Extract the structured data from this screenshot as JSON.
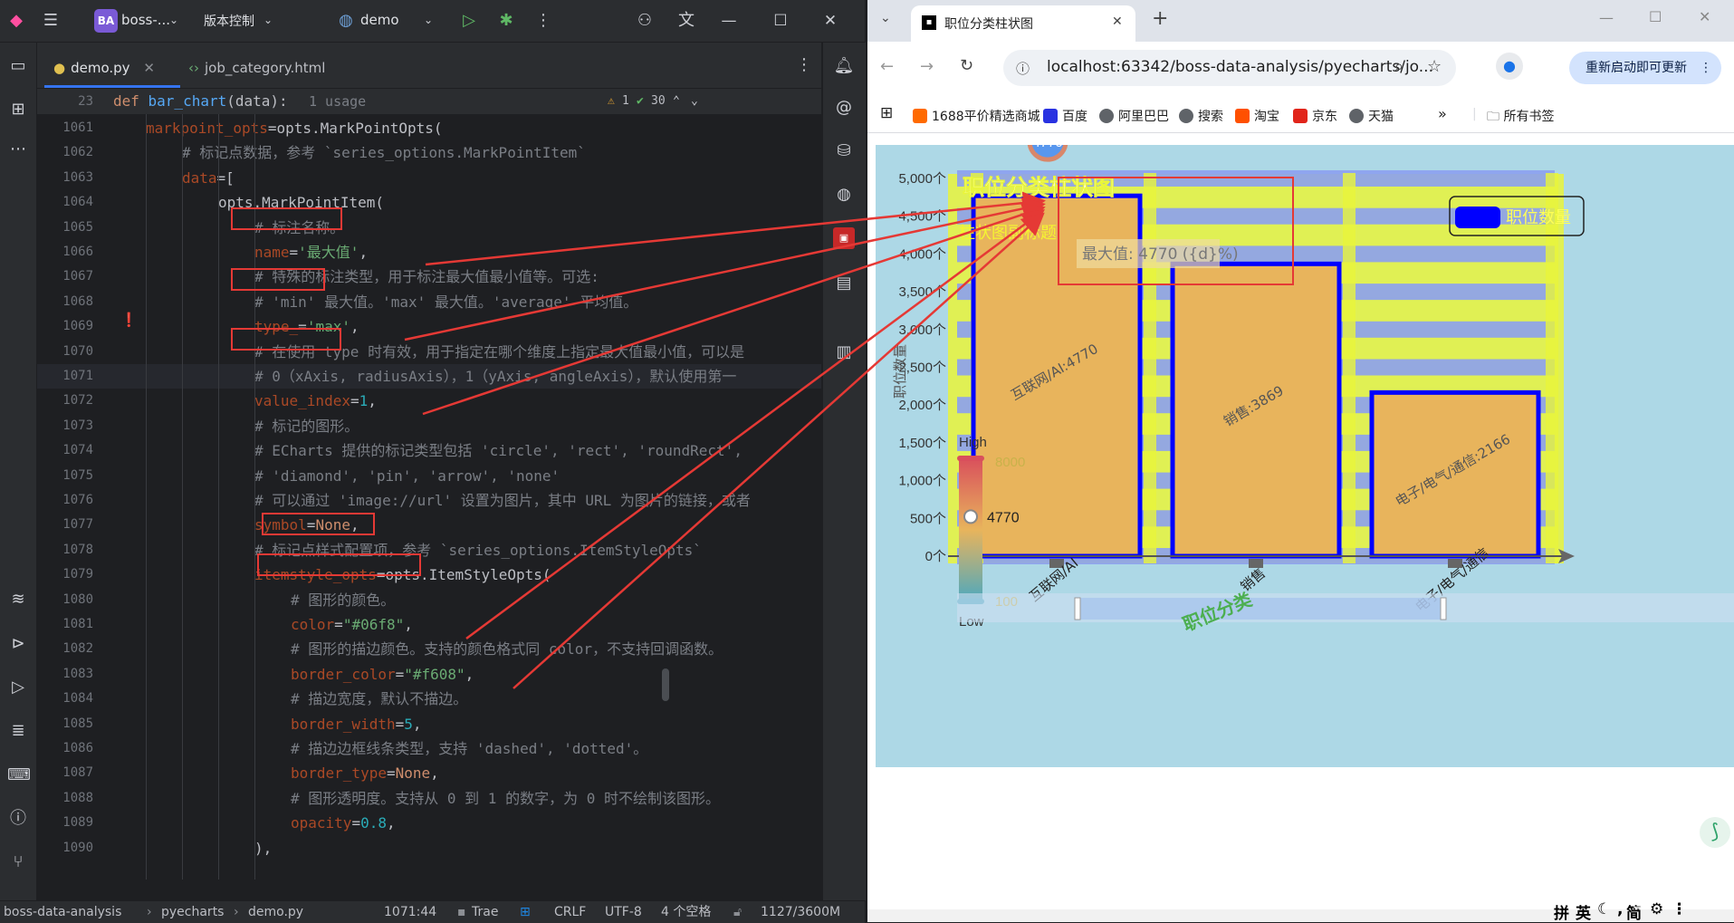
{
  "ide": {
    "project_badge": "BA",
    "project_name": "boss-...",
    "vcs_label": "版本控制",
    "run_config": "demo",
    "tabs": [
      {
        "label": "demo.py",
        "active": true
      },
      {
        "label": "job_category.html",
        "active": false
      }
    ],
    "sticky": {
      "line_no": "23",
      "def_text": "def bar_chart(data):",
      "usages": "1 usage",
      "warnings": "1",
      "checks": "30"
    },
    "lines": [
      {
        "no": "1061",
        "indent": 1,
        "tokens": [
          [
            "pa",
            "markpoint_opts"
          ],
          [
            "",
            "=opts.MarkPointOpts("
          ]
        ]
      },
      {
        "no": "1062",
        "indent": 2,
        "tokens": [
          [
            "cm",
            "# 标记点数据，参考 `series_options.MarkPointItem`"
          ]
        ]
      },
      {
        "no": "1063",
        "indent": 2,
        "tokens": [
          [
            "pa",
            "data"
          ],
          [
            "",
            "=["
          ]
        ]
      },
      {
        "no": "1064",
        "indent": 3,
        "tokens": [
          [
            "",
            "opts.MarkPointItem("
          ]
        ]
      },
      {
        "no": "1065",
        "indent": 4,
        "tokens": [
          [
            "cm",
            "# 标注名称。"
          ]
        ]
      },
      {
        "no": "1066",
        "indent": 4,
        "tokens": [
          [
            "pa",
            "name"
          ],
          [
            "",
            "="
          ],
          [
            "str",
            "'最大值'"
          ],
          [
            "",
            ","
          ]
        ]
      },
      {
        "no": "1067",
        "indent": 4,
        "tokens": [
          [
            "cm",
            "# 特殊的标注类型，用于标注最大值最小值等。可选:"
          ]
        ]
      },
      {
        "no": "1068",
        "indent": 4,
        "tokens": [
          [
            "cm",
            "# 'min' 最大值。'max' 最大值。'average' 平均值。"
          ]
        ]
      },
      {
        "no": "1069",
        "indent": 4,
        "tokens": [
          [
            "pa",
            "type_"
          ],
          [
            "",
            "="
          ],
          [
            "str",
            "'max'"
          ],
          [
            "",
            ","
          ]
        ]
      },
      {
        "no": "1070",
        "indent": 4,
        "tokens": [
          [
            "cm",
            "# 在使用 type 时有效，用于指定在哪个维度上指定最大值最小值，可以是"
          ]
        ]
      },
      {
        "no": "1071",
        "indent": 4,
        "tokens": [
          [
            "cm",
            "# 0（xAxis, radiusAxis），1（yAxis, angleAxis），默认使用第一"
          ]
        ]
      },
      {
        "no": "1072",
        "indent": 4,
        "tokens": [
          [
            "pa",
            "value_index"
          ],
          [
            "",
            "="
          ],
          [
            "num",
            "1"
          ],
          [
            "",
            ","
          ]
        ]
      },
      {
        "no": "1073",
        "indent": 4,
        "tokens": [
          [
            "cm",
            "# 标记的图形。"
          ]
        ]
      },
      {
        "no": "1074",
        "indent": 4,
        "tokens": [
          [
            "cm",
            "# ECharts 提供的标记类型包括 'circle', 'rect', 'roundRect',"
          ]
        ]
      },
      {
        "no": "1075",
        "indent": 4,
        "tokens": [
          [
            "cm",
            "# 'diamond', 'pin', 'arrow', 'none'"
          ]
        ]
      },
      {
        "no": "1076",
        "indent": 4,
        "tokens": [
          [
            "cm",
            "# 可以通过 'image://url' 设置为图片，其中 URL 为图片的链接，或者"
          ]
        ]
      },
      {
        "no": "1077",
        "indent": 4,
        "tokens": [
          [
            "pa",
            "symbol"
          ],
          [
            "",
            "="
          ],
          [
            "kw",
            "None"
          ],
          [
            "",
            ","
          ]
        ]
      },
      {
        "no": "1078",
        "indent": 4,
        "tokens": [
          [
            "cm",
            "# 标记点样式配置项，参考 `series_options.ItemStyleOpts`"
          ]
        ]
      },
      {
        "no": "1079",
        "indent": 4,
        "tokens": [
          [
            "pa",
            "itemstyle_opts"
          ],
          [
            "",
            "=opts.ItemStyleOpts("
          ]
        ]
      },
      {
        "no": "1080",
        "indent": 5,
        "tokens": [
          [
            "cm",
            "# 图形的颜色。"
          ]
        ]
      },
      {
        "no": "1081",
        "indent": 5,
        "tokens": [
          [
            "pa",
            "color"
          ],
          [
            "",
            "="
          ],
          [
            "str",
            "\"#06f8\""
          ],
          [
            "",
            ","
          ]
        ]
      },
      {
        "no": "1082",
        "indent": 5,
        "tokens": [
          [
            "cm",
            "# 图形的描边颜色。支持的颜色格式同 color，不支持回调函数。"
          ]
        ]
      },
      {
        "no": "1083",
        "indent": 5,
        "tokens": [
          [
            "pa",
            "border_color"
          ],
          [
            "",
            "="
          ],
          [
            "str",
            "\"#f608\""
          ],
          [
            "",
            ","
          ]
        ]
      },
      {
        "no": "1084",
        "indent": 5,
        "tokens": [
          [
            "cm",
            "# 描边宽度，默认不描边。"
          ]
        ]
      },
      {
        "no": "1085",
        "indent": 5,
        "tokens": [
          [
            "pa",
            "border_width"
          ],
          [
            "",
            "="
          ],
          [
            "num",
            "5"
          ],
          [
            "",
            ","
          ]
        ]
      },
      {
        "no": "1086",
        "indent": 5,
        "tokens": [
          [
            "cm",
            "# 描边边框线条类型，支持 'dashed', 'dotted'。"
          ]
        ]
      },
      {
        "no": "1087",
        "indent": 5,
        "tokens": [
          [
            "pa",
            "border_type"
          ],
          [
            "",
            "="
          ],
          [
            "kw",
            "None"
          ],
          [
            "",
            ","
          ]
        ]
      },
      {
        "no": "1088",
        "indent": 5,
        "tokens": [
          [
            "cm",
            "# 图形透明度。支持从 0 到 1 的数字，为 0 时不绘制该图形。"
          ]
        ]
      },
      {
        "no": "1089",
        "indent": 5,
        "tokens": [
          [
            "pa",
            "opacity"
          ],
          [
            "",
            "="
          ],
          [
            "num",
            "0.8"
          ],
          [
            "",
            ","
          ]
        ]
      },
      {
        "no": "1090",
        "indent": 4,
        "tokens": [
          [
            "",
            "),"
          ]
        ]
      }
    ],
    "status": {
      "project": "boss-data-analysis",
      "folder": "pyecharts",
      "file": "demo.py",
      "position": "1071:44",
      "sdk": "Trae",
      "line_sep": "CRLF",
      "encoding": "UTF-8",
      "indent": "4 个空格",
      "memory": "1127/3600M"
    }
  },
  "browser": {
    "tab_title": "职位分类柱状图",
    "url": "localhost:63342/boss-data-analysis/pyecharts/jo...",
    "relaunch_label": "重新启动即可更新",
    "bookmarks": [
      {
        "label": "1688平价精选商城",
        "color": "#ff6a00"
      },
      {
        "label": "百度",
        "color": "#2932e1"
      },
      {
        "label": "阿里巴巴",
        "color": "#5f6368"
      },
      {
        "label": "搜索",
        "color": "#5f6368"
      },
      {
        "label": "淘宝",
        "color": "#ff5000"
      },
      {
        "label": "京东",
        "color": "#e1251b"
      },
      {
        "label": "天猫",
        "color": "#5f6368"
      }
    ],
    "all_bookmarks": "所有书签"
  },
  "chart_data": {
    "type": "bar",
    "title": "职位分类柱状图",
    "subtitle": "柱状图副标题",
    "ylabel": "职位数量",
    "xlabel": "职位分类",
    "ylim": [
      0,
      5000
    ],
    "yticks": [
      "0个",
      "500个",
      "1,000个",
      "1,500个",
      "2,000个",
      "2,500个",
      "3,000个",
      "3,500个",
      "4,000个",
      "4,500个",
      "5,000个"
    ],
    "categories": [
      "互联网/AI",
      "销售",
      "电子/电气/通信"
    ],
    "series": [
      {
        "name": "职位数量",
        "values": [
          4770,
          3869,
          2166
        ]
      }
    ],
    "data_labels": [
      "互联网/AI:4770",
      "销售:3869",
      "电子/电气/通信:2166"
    ],
    "markpoint": {
      "label": "4770",
      "tooltip": "最大值: 4770 ({d}%)"
    },
    "visualmap": {
      "high": "High",
      "low": "Low",
      "max_label": "8000",
      "min_label": "100",
      "current": "4770"
    },
    "bar_fill": "#e8b45c",
    "bar_border": "#0000ff",
    "grid": true,
    "legend": "top-right"
  }
}
